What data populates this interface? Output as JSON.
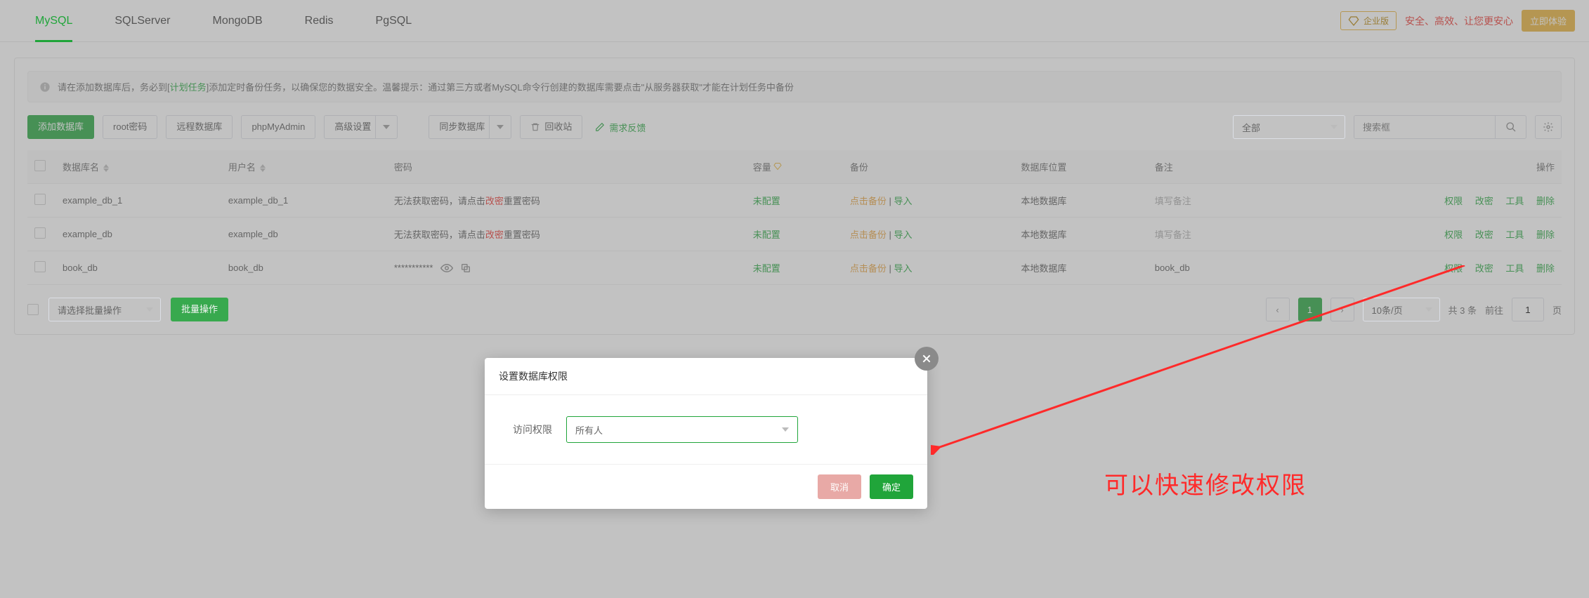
{
  "tabs": {
    "items": [
      "MySQL",
      "SQLServer",
      "MongoDB",
      "Redis",
      "PgSQL"
    ],
    "active_index": 0
  },
  "header": {
    "enterprise_label": "企业版",
    "promo": "安全、高效、让您更安心",
    "try_label": "立即体验"
  },
  "notice": {
    "prefix": "请在添加数据库后，务必到[",
    "link": "计划任务",
    "suffix": "]添加定时备份任务，以确保您的数据安全。温馨提示：通过第三方或者MySQL命令行创建的数据库需要点击\"从服务器获取\"才能在计划任务中备份"
  },
  "toolbar": {
    "add": "添加数据库",
    "root": "root密码",
    "remote": "远程数据库",
    "pma": "phpMyAdmin",
    "adv": "高级设置",
    "sync": "同步数据库",
    "recycle": "回收站",
    "feedback": "需求反馈",
    "filter": "全部",
    "search_placeholder": "搜索框"
  },
  "columns": {
    "name": "数据库名",
    "user": "用户名",
    "password": "密码",
    "capacity": "容量",
    "backup": "备份",
    "location": "数据库位置",
    "remark": "备注",
    "ops": "操作"
  },
  "password_hint": {
    "pre": "无法获取密码，请点击",
    "mid": "改密",
    "post": "重置密码"
  },
  "backup": {
    "click": "点击备份",
    "sep": " | ",
    "import": "导入",
    "none": "未配置"
  },
  "remark_placeholder": "填写备注",
  "ops": {
    "perm": "权限",
    "chpw": "改密",
    "tool": "工具",
    "del": "删除"
  },
  "rows": [
    {
      "name": "example_db_1",
      "user": "example_db_1",
      "pw_type": "hint",
      "loc": "本地数据库",
      "remark": ""
    },
    {
      "name": "example_db",
      "user": "example_db",
      "pw_type": "hint",
      "loc": "本地数据库",
      "remark": ""
    },
    {
      "name": "book_db",
      "user": "book_db",
      "pw_type": "mask",
      "pw_mask": "***********",
      "loc": "本地数据库",
      "remark": "book_db"
    }
  ],
  "footer": {
    "batch_placeholder": "请选择批量操作",
    "batch_btn": "批量操作",
    "page_size": "10条/页",
    "total": "共 3 条",
    "goto_label": "前往",
    "goto_value": "1",
    "goto_suffix": "页",
    "current_page": "1"
  },
  "modal": {
    "title": "设置数据库权限",
    "label": "访问权限",
    "value": "所有人",
    "cancel": "取消",
    "ok": "确定"
  },
  "annotation": "可以快速修改权限"
}
